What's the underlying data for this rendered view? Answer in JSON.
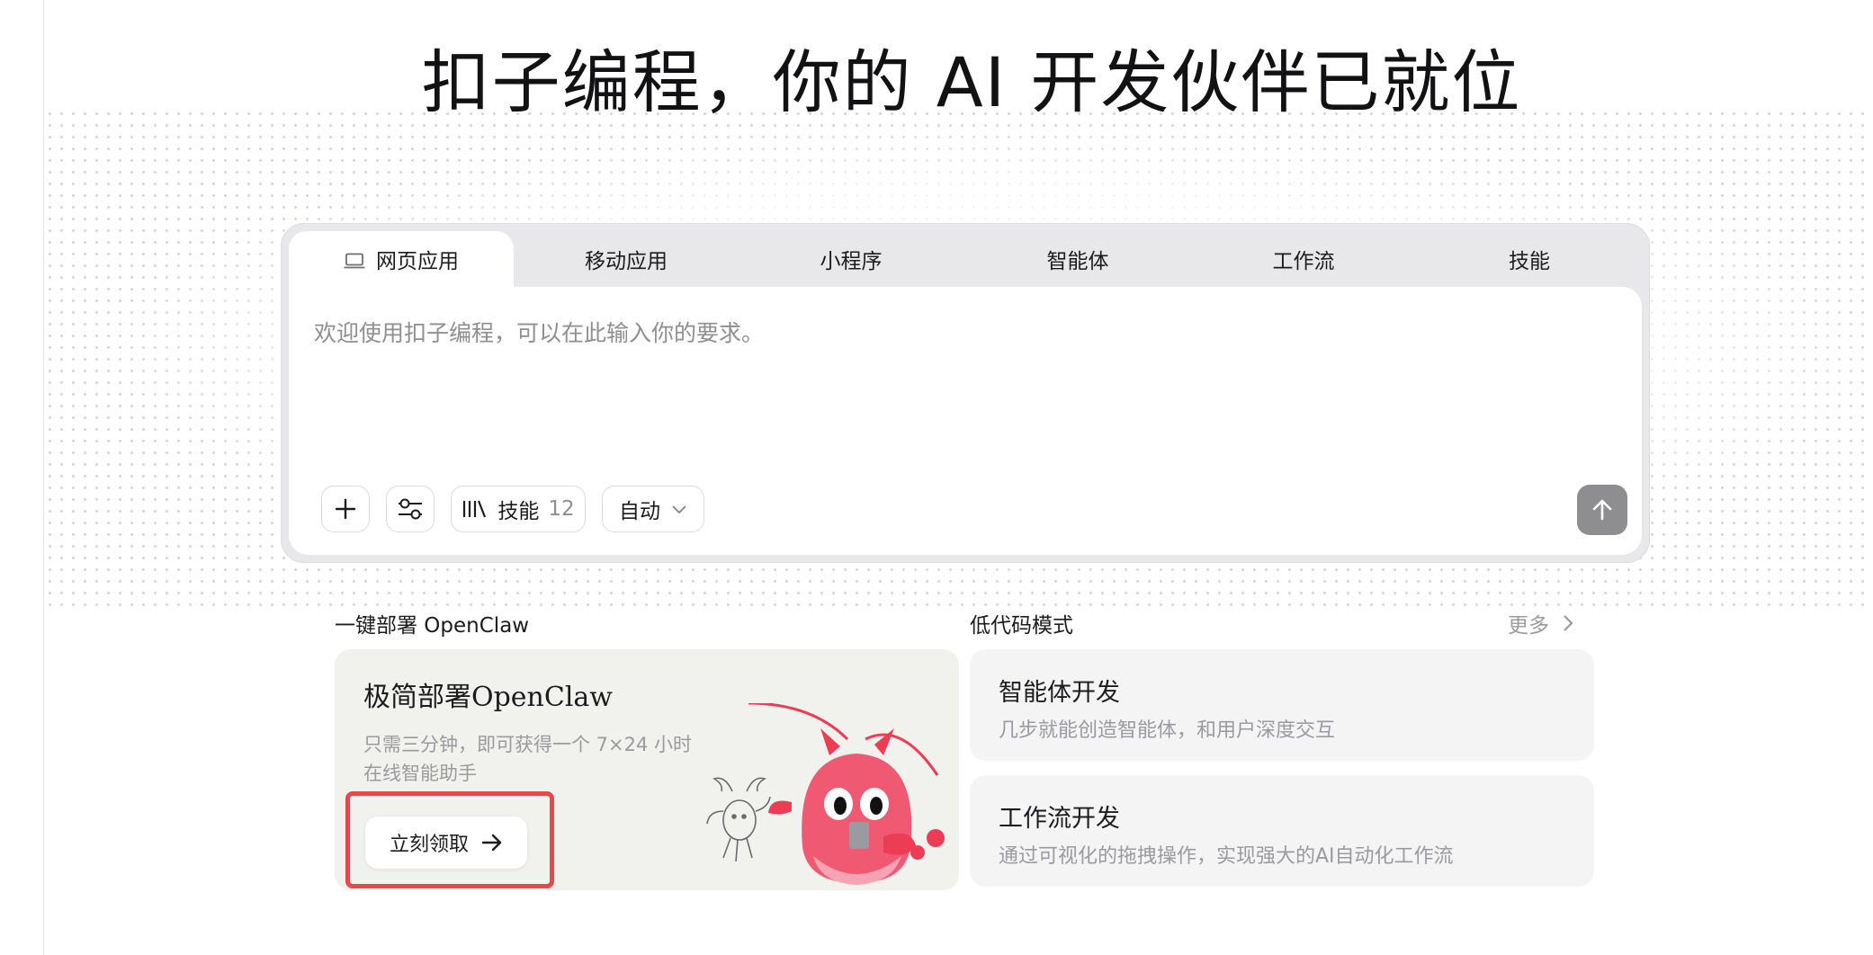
{
  "hero": {
    "title": "扣子编程，你的 AI 开发伙伴已就位"
  },
  "composer": {
    "tabs": [
      {
        "label": "网页应用",
        "icon": "laptop-icon",
        "active": true
      },
      {
        "label": "移动应用"
      },
      {
        "label": "小程序"
      },
      {
        "label": "智能体"
      },
      {
        "label": "工作流"
      },
      {
        "label": "技能"
      }
    ],
    "placeholder": "欢迎使用扣子编程，可以在此输入你的要求。",
    "skills_label": "技能",
    "skills_count": "12",
    "mode_label": "自动"
  },
  "openclaw": {
    "section_title": "一键部署 OpenClaw",
    "card_title": "极简部署OpenClaw",
    "card_desc": "只需三分钟，即可获得一个 7×24 小时在线智能助手",
    "cta_label": "立刻领取"
  },
  "lowcode": {
    "section_title": "低代码模式",
    "more_label": "更多",
    "cards": [
      {
        "title": "智能体开发",
        "desc": "几步就能创造智能体，和用户深度交互"
      },
      {
        "title": "工作流开发",
        "desc": "通过可视化的拖拽操作，实现强大的AI自动化工作流"
      }
    ]
  },
  "colors": {
    "highlight": "#e8474c",
    "send_button": "#8e8e90",
    "lobster": "#ec3d55"
  }
}
